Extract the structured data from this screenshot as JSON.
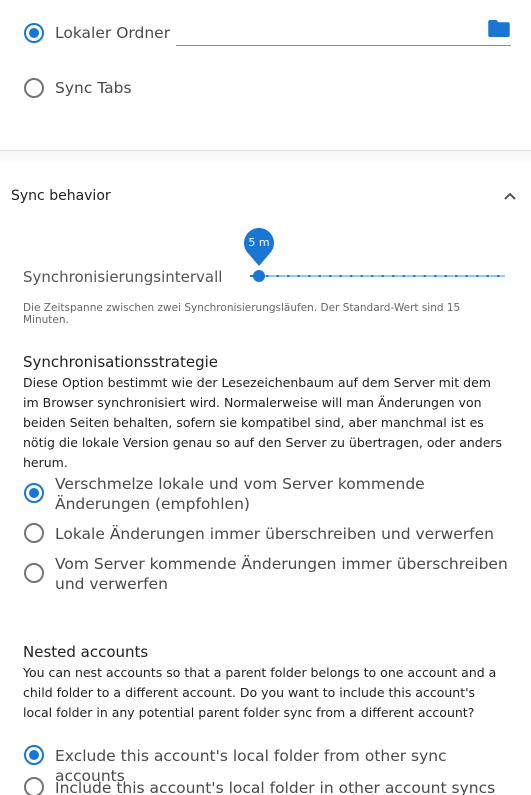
{
  "storage": {
    "local_folder_label": "Lokaler Ordner",
    "local_folder_value": "",
    "sync_tabs_label": "Sync Tabs",
    "folder_icon": "folder-icon",
    "accent": "#1976d2"
  },
  "sync_behavior": {
    "title": "Sync behavior",
    "chevron_icon": "chevron-up-icon",
    "interval": {
      "label": "Synchronisierungsintervall",
      "value_label": "5 m",
      "hint": "Die Zeitspanne zwischen zwei Synchronisierungsläufen. Der Standard-Wert sind 15 Minuten."
    },
    "strategy": {
      "title": "Synchronisationsstrategie",
      "description": "Diese Option bestimmt wie der Lesezeichenbaum auf dem Server mit dem im Browser synchronisiert wird. Normalerweise will man Änderungen von beiden Seiten behalten, sofern sie kompatibel sind, aber manchmal ist es nötig die lokale Version genau so auf den Server zu übertragen, oder anders herum.",
      "options": [
        {
          "label": "Verschmelze lokale und vom Server kommende Änderungen (empfohlen)",
          "checked": true
        },
        {
          "label": "Lokale Änderungen immer überschreiben und verwerfen",
          "checked": false
        },
        {
          "label": "Vom Server kommende Änderungen immer überschreiben und verwerfen",
          "checked": false
        }
      ]
    },
    "nested": {
      "title": "Nested accounts",
      "description": "You can nest accounts so that a parent folder belongs to one account and a child folder to a different account. Do you want to include this account's local folder in any potential parent folder sync from a different account?",
      "options": [
        {
          "label": "Exclude this account's local folder from other sync accounts",
          "checked": true
        },
        {
          "label": "Include this account's local folder in other account syncs",
          "checked": false
        }
      ]
    }
  }
}
